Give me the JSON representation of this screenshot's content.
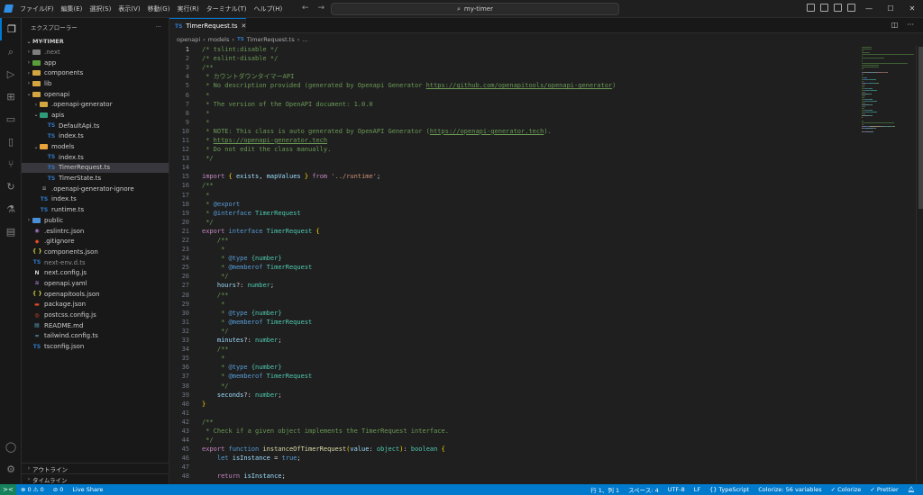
{
  "titlebar": {
    "menu": [
      "ファイル(F)",
      "編集(E)",
      "選択(S)",
      "表示(V)",
      "移動(G)",
      "実行(R)",
      "ターミナル(T)",
      "ヘルプ(H)"
    ],
    "search": "my-timer"
  },
  "sidebar": {
    "header": "エクスプローラー",
    "root": "MY-TIMER",
    "items": [
      {
        "label": ".next",
        "type": "folder",
        "depth": 0,
        "color": "#7e7e7e",
        "dim": true
      },
      {
        "label": "app",
        "type": "folder",
        "depth": 0,
        "color": "#5a9e3c"
      },
      {
        "label": "components",
        "type": "folder",
        "depth": 0,
        "color": "#d3a642"
      },
      {
        "label": "lib",
        "type": "folder",
        "depth": 0,
        "color": "#d3a642"
      },
      {
        "label": "openapi",
        "type": "folder-open",
        "depth": 0,
        "color": "#d3a642"
      },
      {
        "label": ".openapi-generator",
        "type": "folder",
        "depth": 1,
        "color": "#d3a642"
      },
      {
        "label": "apis",
        "type": "folder-open",
        "depth": 1,
        "color": "#2e9b7a"
      },
      {
        "label": "DefaultApi.ts",
        "type": "ts",
        "depth": 2
      },
      {
        "label": "index.ts",
        "type": "ts",
        "depth": 2
      },
      {
        "label": "models",
        "type": "folder-open",
        "depth": 1,
        "color": "#e8a23a"
      },
      {
        "label": "index.ts",
        "type": "ts",
        "depth": 2
      },
      {
        "label": "TimerRequest.ts",
        "type": "ts",
        "depth": 2,
        "selected": true
      },
      {
        "label": "TimerState.ts",
        "type": "ts",
        "depth": 2
      },
      {
        "label": ".openapi-generator-ignore",
        "type": "file",
        "depth": 1
      },
      {
        "label": "index.ts",
        "type": "ts",
        "depth": 1
      },
      {
        "label": "runtime.ts",
        "type": "ts",
        "depth": 1
      },
      {
        "label": "public",
        "type": "folder",
        "depth": 0,
        "color": "#4a8fd6"
      },
      {
        "label": ".eslintrc.json",
        "type": "eslint",
        "depth": 0
      },
      {
        "label": ".gitignore",
        "type": "git",
        "depth": 0
      },
      {
        "label": "components.json",
        "type": "json",
        "depth": 0
      },
      {
        "label": "next-env.d.ts",
        "type": "ts",
        "depth": 0,
        "dim": true
      },
      {
        "label": "next.config.js",
        "type": "next",
        "depth": 0
      },
      {
        "label": "openapi.yaml",
        "type": "yaml",
        "depth": 0
      },
      {
        "label": "openapitools.json",
        "type": "json",
        "depth": 0
      },
      {
        "label": "package.json",
        "type": "npm",
        "depth": 0
      },
      {
        "label": "postcss.config.js",
        "type": "postcss",
        "depth": 0
      },
      {
        "label": "README.md",
        "type": "md",
        "depth": 0
      },
      {
        "label": "tailwind.config.ts",
        "type": "tailwind",
        "depth": 0
      },
      {
        "label": "tsconfig.json",
        "type": "tsconfig",
        "depth": 0
      }
    ],
    "outline": "アウトライン",
    "timeline": "タイムライン"
  },
  "tab": {
    "label": "TimerRequest.ts",
    "icon": "TS"
  },
  "breadcrumb": [
    "openapi",
    "models",
    "TimerRequest.ts",
    "..."
  ],
  "editor": {
    "current_line": 1,
    "lines": [
      [
        [
          "c",
          "/* tslint:disable */"
        ]
      ],
      [
        [
          "c",
          "/* eslint-disable */"
        ]
      ],
      [
        [
          "c",
          "/**"
        ]
      ],
      [
        [
          "c",
          " * カウントダウンタイマーAPI"
        ]
      ],
      [
        [
          "c",
          " * No description provided (generated by Openapi Generator "
        ],
        [
          "lnk",
          "https://github.com/openapitools/openapi-generator"
        ],
        [
          "c",
          ")"
        ]
      ],
      [
        [
          "c",
          " *"
        ]
      ],
      [
        [
          "c",
          " * The version of the OpenAPI document: 1.0.0"
        ]
      ],
      [
        [
          "c",
          " *"
        ]
      ],
      [
        [
          "c",
          " *"
        ]
      ],
      [
        [
          "c",
          " * NOTE: This class is auto generated by OpenAPI Generator ("
        ],
        [
          "lnk",
          "https://openapi-generator.tech"
        ],
        [
          "c",
          ")."
        ]
      ],
      [
        [
          "c",
          " * "
        ],
        [
          "lnk",
          "https://openapi-generator.tech"
        ]
      ],
      [
        [
          "c",
          " * Do not edit the class manually."
        ]
      ],
      [
        [
          "c",
          " */"
        ]
      ],
      [],
      [
        [
          "kw",
          "import"
        ],
        [
          "pl",
          " "
        ],
        [
          "br",
          "{"
        ],
        [
          "pl",
          " "
        ],
        [
          "pr",
          "exists"
        ],
        [
          "pl",
          ", "
        ],
        [
          "pr",
          "mapValues"
        ],
        [
          "pl",
          " "
        ],
        [
          "br",
          "}"
        ],
        [
          "pl",
          " "
        ],
        [
          "kw",
          "from"
        ],
        [
          "pl",
          " "
        ],
        [
          "st",
          "'../runtime'"
        ],
        [
          "pl",
          ";"
        ]
      ],
      [
        [
          "c",
          "/**"
        ]
      ],
      [
        [
          "c",
          " *"
        ]
      ],
      [
        [
          "c",
          " * "
        ],
        [
          "jd",
          "@export"
        ]
      ],
      [
        [
          "c",
          " * "
        ],
        [
          "jd",
          "@interface"
        ],
        [
          "c",
          " "
        ],
        [
          "ty",
          "TimerRequest"
        ]
      ],
      [
        [
          "c",
          " */"
        ]
      ],
      [
        [
          "kw",
          "export"
        ],
        [
          "pl",
          " "
        ],
        [
          "k",
          "interface"
        ],
        [
          "pl",
          " "
        ],
        [
          "ty",
          "TimerRequest"
        ],
        [
          "pl",
          " "
        ],
        [
          "br",
          "{"
        ]
      ],
      [
        [
          "c",
          "    /**"
        ]
      ],
      [
        [
          "c",
          "     *"
        ]
      ],
      [
        [
          "c",
          "     * "
        ],
        [
          "jd",
          "@type"
        ],
        [
          "c",
          " "
        ],
        [
          "ty",
          "{number}"
        ]
      ],
      [
        [
          "c",
          "     * "
        ],
        [
          "jd",
          "@memberof"
        ],
        [
          "c",
          " "
        ],
        [
          "ty",
          "TimerRequest"
        ]
      ],
      [
        [
          "c",
          "     */"
        ]
      ],
      [
        [
          "pl",
          "    "
        ],
        [
          "pr",
          "hours"
        ],
        [
          "pl",
          "?: "
        ],
        [
          "ty",
          "number"
        ],
        [
          "pl",
          ";"
        ]
      ],
      [
        [
          "c",
          "    /**"
        ]
      ],
      [
        [
          "c",
          "     *"
        ]
      ],
      [
        [
          "c",
          "     * "
        ],
        [
          "jd",
          "@type"
        ],
        [
          "c",
          " "
        ],
        [
          "ty",
          "{number}"
        ]
      ],
      [
        [
          "c",
          "     * "
        ],
        [
          "jd",
          "@memberof"
        ],
        [
          "c",
          " "
        ],
        [
          "ty",
          "TimerRequest"
        ]
      ],
      [
        [
          "c",
          "     */"
        ]
      ],
      [
        [
          "pl",
          "    "
        ],
        [
          "pr",
          "minutes"
        ],
        [
          "pl",
          "?: "
        ],
        [
          "ty",
          "number"
        ],
        [
          "pl",
          ";"
        ]
      ],
      [
        [
          "c",
          "    /**"
        ]
      ],
      [
        [
          "c",
          "     *"
        ]
      ],
      [
        [
          "c",
          "     * "
        ],
        [
          "jd",
          "@type"
        ],
        [
          "c",
          " "
        ],
        [
          "ty",
          "{number}"
        ]
      ],
      [
        [
          "c",
          "     * "
        ],
        [
          "jd",
          "@memberof"
        ],
        [
          "c",
          " "
        ],
        [
          "ty",
          "TimerRequest"
        ]
      ],
      [
        [
          "c",
          "     */"
        ]
      ],
      [
        [
          "pl",
          "    "
        ],
        [
          "pr",
          "seconds"
        ],
        [
          "pl",
          "?: "
        ],
        [
          "ty",
          "number"
        ],
        [
          "pl",
          ";"
        ]
      ],
      [
        [
          "br",
          "}"
        ]
      ],
      [],
      [
        [
          "c",
          "/**"
        ]
      ],
      [
        [
          "c",
          " * Check if a given object implements the TimerRequest interface."
        ]
      ],
      [
        [
          "c",
          " */"
        ]
      ],
      [
        [
          "kw",
          "export"
        ],
        [
          "pl",
          " "
        ],
        [
          "k",
          "function"
        ],
        [
          "pl",
          " "
        ],
        [
          "fn",
          "instanceOfTimerRequest"
        ],
        [
          "br",
          "("
        ],
        [
          "pr",
          "value"
        ],
        [
          "pl",
          ": "
        ],
        [
          "ty",
          "object"
        ],
        [
          "br",
          ")"
        ],
        [
          "pl",
          ": "
        ],
        [
          "ty",
          "boolean"
        ],
        [
          "pl",
          " "
        ],
        [
          "br",
          "{"
        ]
      ],
      [
        [
          "pl",
          "    "
        ],
        [
          "k",
          "let"
        ],
        [
          "pl",
          " "
        ],
        [
          "pr",
          "isInstance"
        ],
        [
          "pl",
          " = "
        ],
        [
          "k",
          "true"
        ],
        [
          "pl",
          ";"
        ]
      ],
      [],
      [
        [
          "pl",
          "    "
        ],
        [
          "kw",
          "return"
        ],
        [
          "pl",
          " "
        ],
        [
          "pr",
          "isInstance"
        ],
        [
          "pl",
          ";"
        ]
      ]
    ]
  },
  "status": {
    "remote_icon": "><",
    "problems": "⊗ 0 ⚠ 0",
    "ports": "⊘ 0",
    "live_share": "Live Share",
    "position": "行 1、列 1",
    "spaces": "スペース: 4",
    "encoding": "UTF-8",
    "eol": "LF",
    "language": "{} TypeScript",
    "colorize": "Colorize: 56 variables",
    "colorize_btn": "✓ Colorize",
    "prettier": "✓ Prettier"
  }
}
